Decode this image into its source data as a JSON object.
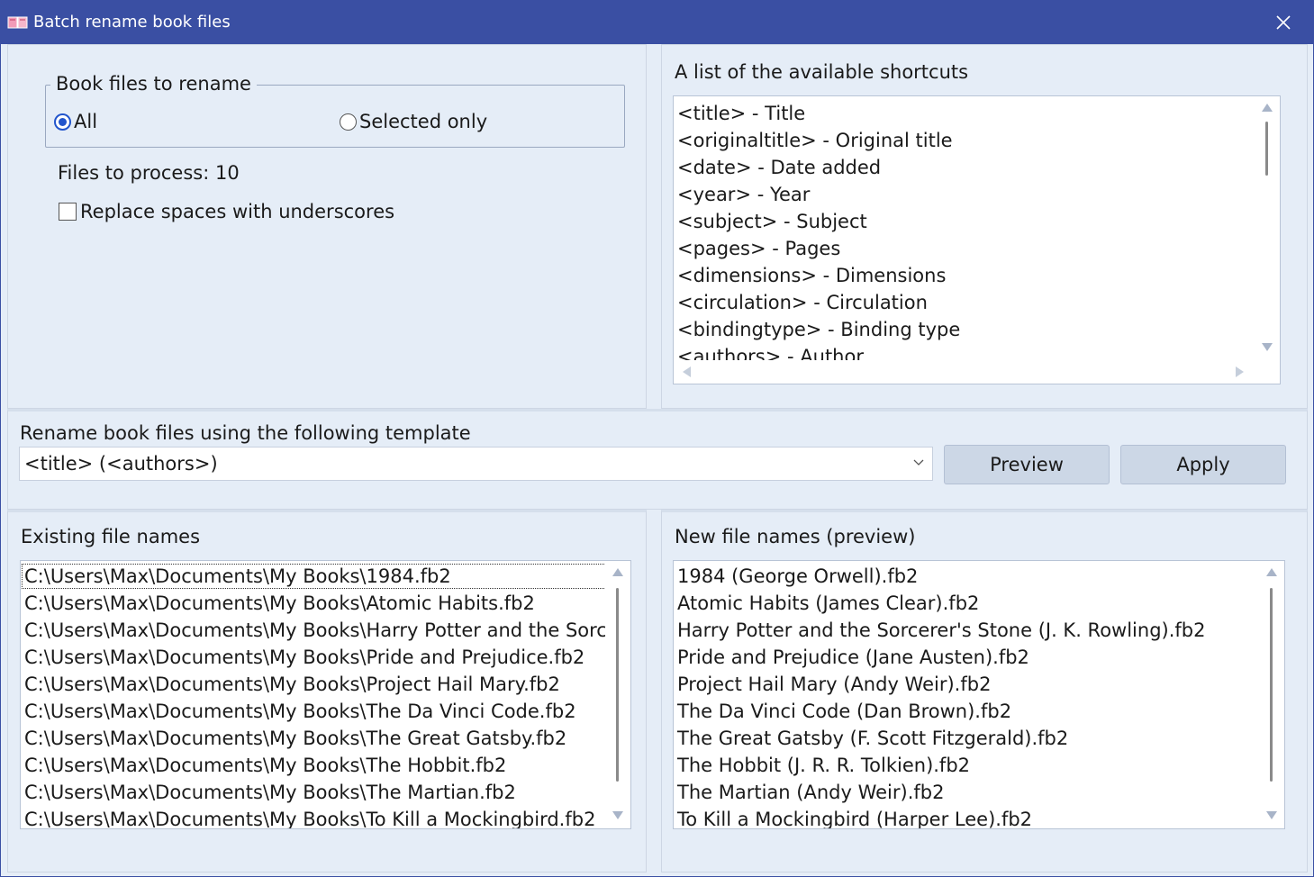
{
  "window": {
    "title": "Batch rename book files",
    "colors": {
      "titlebar": "#3a4fa3",
      "background": "#e5edf7",
      "accent": "#2255cc"
    }
  },
  "options": {
    "group_title": "Book files to rename",
    "radio_all": "All",
    "radio_selected": "Selected only",
    "selected_radio": "All",
    "files_to_process": "Files to process: 10",
    "replace_spaces_label": "Replace spaces with underscores",
    "replace_spaces_checked": false
  },
  "shortcuts": {
    "label": "A list of the available shortcuts",
    "items": [
      "<title> - Title",
      "<originaltitle> - Original title",
      "<date> - Date added",
      "<year> - Year",
      "<subject> - Subject",
      "<pages> - Pages",
      "<dimensions> - Dimensions",
      "<circulation> - Circulation",
      "<bindingtype> - Binding type",
      "<authors> - Author"
    ]
  },
  "template": {
    "label": "Rename book files using the following template",
    "value": "<title> (<authors>)",
    "preview_button": "Preview",
    "apply_button": "Apply"
  },
  "existing": {
    "label": "Existing file names",
    "items": [
      "C:\\Users\\Max\\Documents\\My Books\\1984.fb2",
      "C:\\Users\\Max\\Documents\\My Books\\Atomic Habits.fb2",
      "C:\\Users\\Max\\Documents\\My Books\\Harry Potter and the Sorcerer",
      "C:\\Users\\Max\\Documents\\My Books\\Pride and Prejudice.fb2",
      "C:\\Users\\Max\\Documents\\My Books\\Project Hail Mary.fb2",
      "C:\\Users\\Max\\Documents\\My Books\\The Da Vinci Code.fb2",
      "C:\\Users\\Max\\Documents\\My Books\\The Great Gatsby.fb2",
      "C:\\Users\\Max\\Documents\\My Books\\The Hobbit.fb2",
      "C:\\Users\\Max\\Documents\\My Books\\The Martian.fb2",
      "C:\\Users\\Max\\Documents\\My Books\\To Kill a Mockingbird.fb2"
    ]
  },
  "preview": {
    "label": "New file names (preview)",
    "items": [
      "1984 (George Orwell).fb2",
      "Atomic Habits (James Clear).fb2",
      "Harry Potter and the Sorcerer's Stone (J. K. Rowling).fb2",
      "Pride and Prejudice (Jane Austen).fb2",
      "Project Hail Mary (Andy Weir).fb2",
      "The Da Vinci Code (Dan Brown).fb2",
      "The Great Gatsby (F. Scott Fitzgerald).fb2",
      "The Hobbit (J. R. R. Tolkien).fb2",
      "The Martian (Andy Weir).fb2",
      "To Kill a Mockingbird (Harper Lee).fb2"
    ]
  }
}
